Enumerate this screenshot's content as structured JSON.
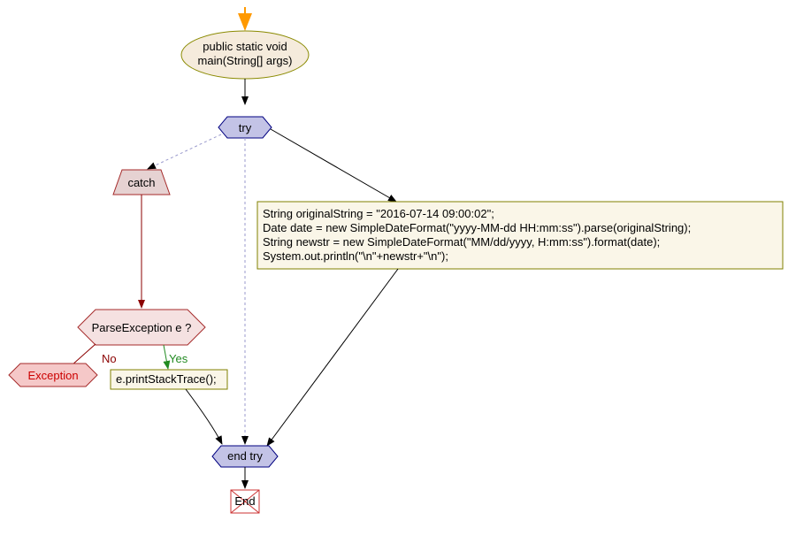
{
  "flowchart": {
    "method_header": {
      "line1": "public static void",
      "line2": "main(String[] args)"
    },
    "try_label": "try",
    "catch_label": "catch",
    "code_block": {
      "line1": "String originalString = \"2016-07-14 09:00:02\";",
      "line2": "Date date = new SimpleDateFormat(\"yyyy-MM-dd HH:mm:ss\").parse(originalString);",
      "line3": "String newstr = new SimpleDateFormat(\"MM/dd/yyyy, H:mm:ss\").format(date);",
      "line4": "System.out.println(\"\\n\"+newstr+\"\\n\");"
    },
    "decision_label": "ParseException e ?",
    "yes_label": "Yes",
    "no_label": "No",
    "exception_label": "Exception",
    "stacktrace_label": "e.printStackTrace();",
    "end_try_label": "end try",
    "end_label": "End"
  },
  "colors": {
    "ellipse_fill": "#f5ebdc",
    "ellipse_stroke": "#8a8a00",
    "hexagon_fill": "#c3c3e6",
    "hexagon_stroke": "#000080",
    "catch_fill": "#e6d2d2",
    "catch_stroke": "#a52a2a",
    "decision_fill": "#f5e1e1",
    "decision_stroke": "#a52a2a",
    "exception_fill": "#f5c8c8",
    "exception_text": "#cc0000",
    "code_fill": "#faf6e8",
    "code_stroke": "#808000",
    "end_stroke": "#cc3333",
    "arrow_black": "#000000",
    "arrow_orange": "#ff9900",
    "arrow_red": "#8b0000",
    "arrow_green": "#228b22",
    "dashed_blue": "#9999cc"
  }
}
